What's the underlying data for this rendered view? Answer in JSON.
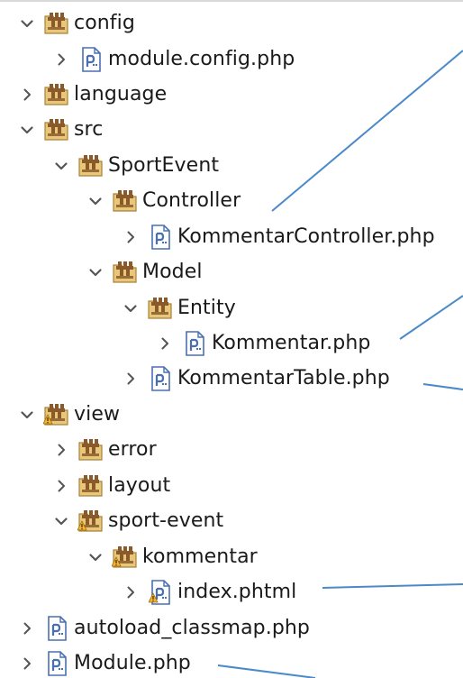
{
  "tree": {
    "items": [
      {
        "label": "config",
        "type": "package",
        "state": "expanded",
        "depth": 0
      },
      {
        "label": "module.config.php",
        "type": "php",
        "state": "collapsed",
        "depth": 1
      },
      {
        "label": "language",
        "type": "package",
        "state": "collapsed",
        "depth": 0
      },
      {
        "label": "src",
        "type": "package",
        "state": "expanded",
        "depth": 0
      },
      {
        "label": "SportEvent",
        "type": "package",
        "state": "expanded",
        "depth": 1
      },
      {
        "label": "Controller",
        "type": "package",
        "state": "expanded",
        "depth": 2
      },
      {
        "label": "KommentarController.php",
        "type": "php",
        "state": "collapsed",
        "depth": 3
      },
      {
        "label": "Model",
        "type": "package",
        "state": "expanded",
        "depth": 2
      },
      {
        "label": "Entity",
        "type": "package",
        "state": "expanded",
        "depth": 3
      },
      {
        "label": "Kommentar.php",
        "type": "php",
        "state": "collapsed",
        "depth": 4
      },
      {
        "label": "KommentarTable.php",
        "type": "php",
        "state": "collapsed",
        "depth": 3
      },
      {
        "label": "view",
        "type": "package-warn",
        "state": "expanded",
        "depth": 0
      },
      {
        "label": "error",
        "type": "package",
        "state": "collapsed",
        "depth": 1
      },
      {
        "label": "layout",
        "type": "package",
        "state": "collapsed",
        "depth": 1
      },
      {
        "label": "sport-event",
        "type": "package-warn",
        "state": "expanded",
        "depth": 1
      },
      {
        "label": "kommentar",
        "type": "package-warn",
        "state": "expanded",
        "depth": 2
      },
      {
        "label": "index.phtml",
        "type": "php-warn",
        "state": "collapsed",
        "depth": 3
      },
      {
        "label": "autoload_classmap.php",
        "type": "php",
        "state": "collapsed",
        "depth": 0
      },
      {
        "label": "Module.php",
        "type": "php",
        "state": "collapsed",
        "depth": 0
      }
    ]
  },
  "colors": {
    "chevron": "#555555",
    "folder": "#e8c77a",
    "folder_outline": "#a8823a",
    "brick": "#8a5a2b",
    "php_blue": "#4a6fb0",
    "warning": "#f2b53a",
    "annotation_line": "#4a8ac8"
  }
}
